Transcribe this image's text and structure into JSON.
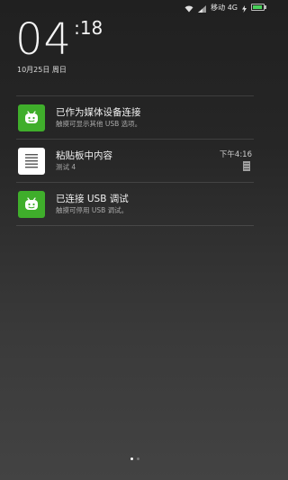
{
  "status_bar": {
    "wifi_icon": "wifi-icon",
    "signal_icon": "signal-icon",
    "carrier": "移动 4G",
    "charging_icon": "lightning-icon",
    "battery_level": 0.95,
    "battery_color": "#49d15a"
  },
  "lockscreen": {
    "clock_hm": "04",
    "clock_sec": "18",
    "date": "10月25日 周日"
  },
  "notifications": [
    {
      "icon": "android-icon",
      "title": "已作为媒体设备连接",
      "subtitle": "触摸可显示其他 USB 选项。"
    },
    {
      "icon": "document-icon",
      "title": "粘贴板中内容",
      "subtitle": "测试 4",
      "time": "下午4:16"
    },
    {
      "icon": "android-icon",
      "title": "已连接 USB 调试",
      "subtitle": "触摸可停用 USB 调试。"
    }
  ],
  "pager": {
    "pages": 2,
    "active": 1
  }
}
